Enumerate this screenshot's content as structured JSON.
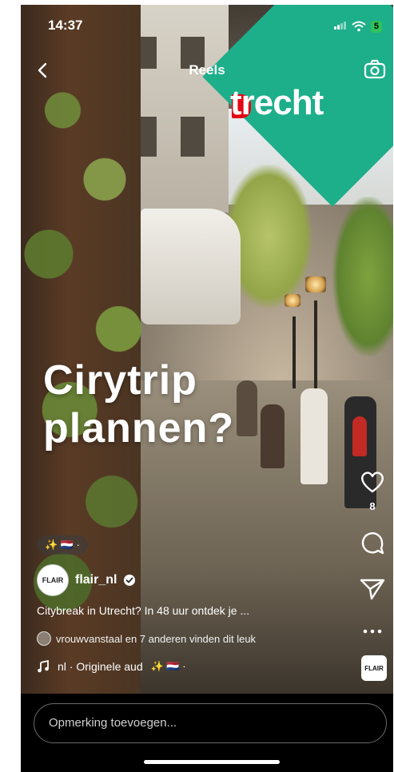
{
  "status_bar": {
    "time": "14:37",
    "battery": "5"
  },
  "header": {
    "title": "Reels"
  },
  "reel": {
    "logo_text": "trecht",
    "overlay_title": "Cirytrip\nplannen?",
    "emoji_chip": "✨ 🇳🇱 ·",
    "account": {
      "username": "flair_nl",
      "avatar_text": "FLAIR"
    },
    "caption": "Citybreak in Utrecht? In 48 uur ontdek je ...",
    "likers": "vrouwvanstaal en 7 anderen vinden dit leuk",
    "audio": {
      "text": "nl · Originele aud",
      "extra": "✨ 🇳🇱 ·",
      "thumb_text": "FLAIR"
    }
  },
  "actions": {
    "like_count": "8"
  },
  "comment": {
    "placeholder": "Opmerking toevoegen..."
  },
  "colors": {
    "logo_green": "#1dae8a",
    "logo_red": "#e30613",
    "battery": "#2fc15a"
  }
}
